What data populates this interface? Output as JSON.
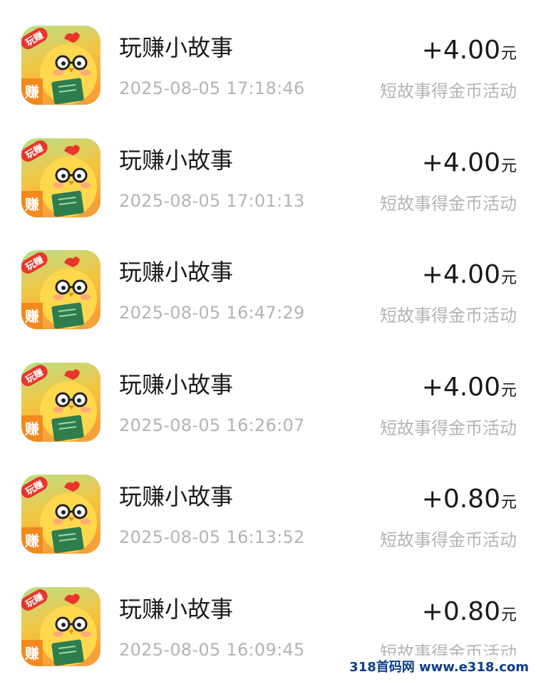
{
  "unit": "元",
  "transactions": [
    {
      "app_name": "玩赚小故事",
      "time": "2025-08-05 17:18:46",
      "amount": "+4.00",
      "description": "短故事得金币活动"
    },
    {
      "app_name": "玩赚小故事",
      "time": "2025-08-05 17:01:13",
      "amount": "+4.00",
      "description": "短故事得金币活动"
    },
    {
      "app_name": "玩赚小故事",
      "time": "2025-08-05 16:47:29",
      "amount": "+4.00",
      "description": "短故事得金币活动"
    },
    {
      "app_name": "玩赚小故事",
      "time": "2025-08-05 16:26:07",
      "amount": "+4.00",
      "description": "短故事得金币活动"
    },
    {
      "app_name": "玩赚小故事",
      "time": "2025-08-05 16:13:52",
      "amount": "+0.80",
      "description": "短故事得金币活动"
    },
    {
      "app_name": "玩赚小故事",
      "time": "2025-08-05 16:09:45",
      "amount": "+0.80",
      "description": "短故事得金币活动"
    }
  ],
  "app_icon": {
    "icon_name": "chick-reading-book-icon",
    "badge_text": "玩赚",
    "side_text": "赚",
    "colors": {
      "bg_top": "#b8e08a",
      "bg_bottom": "#f7a13a",
      "badge": "#e8362c",
      "chick": "#ffd84d",
      "book": "#2f7d4f",
      "comb": "#e8362c"
    }
  },
  "watermark": "318首码网 www.e318.com"
}
